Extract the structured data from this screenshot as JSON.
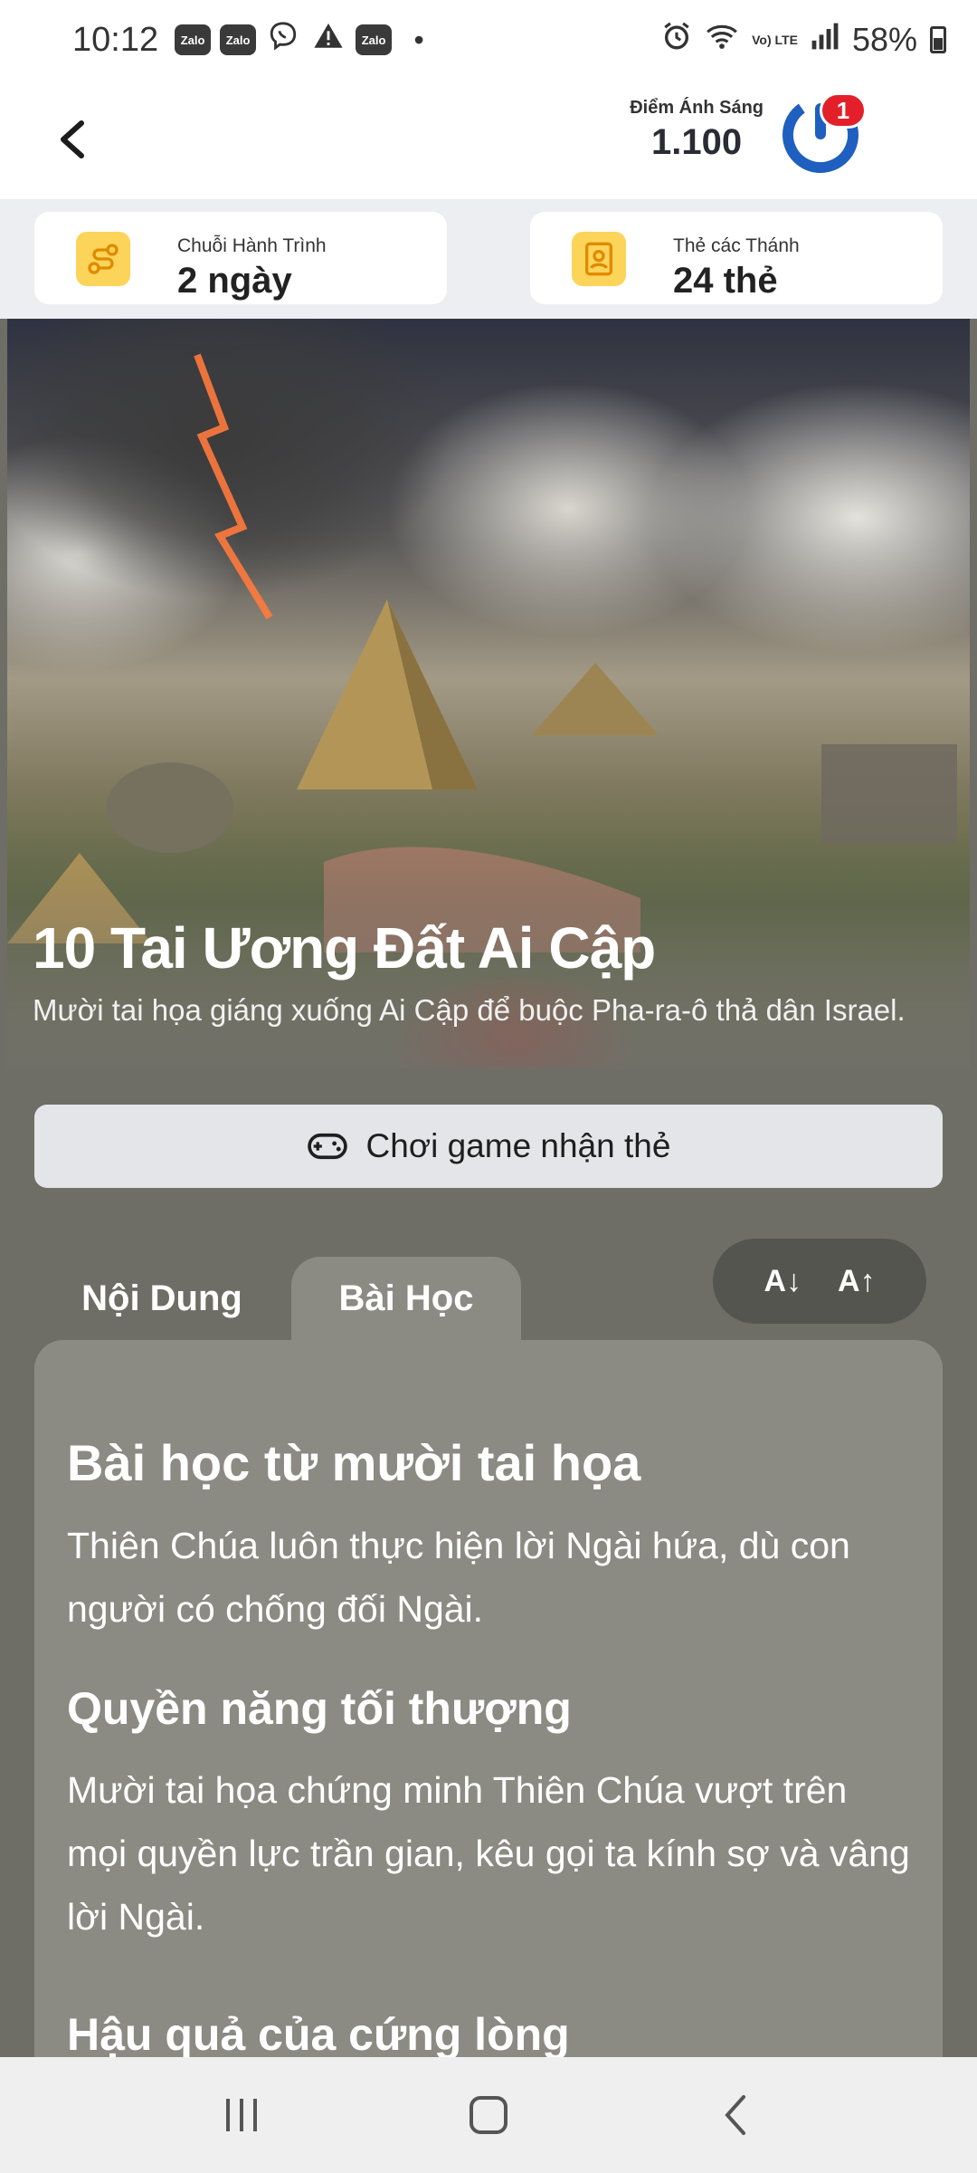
{
  "status_bar": {
    "time": "10:12",
    "notifications": [
      "Zalo",
      "Zalo",
      "viber-icon",
      "warning-icon",
      "Zalo",
      "dot-icon"
    ],
    "network_label": "Vo) LTE",
    "battery": "58%"
  },
  "header": {
    "points_label": "Điểm Ánh Sáng",
    "points_value": "1.100",
    "notification_count": "1",
    "brand_color": "#1e5fbf"
  },
  "stats": {
    "journey_label": "Chuỗi Hành Trình",
    "journey_value": "2 ngày",
    "saints_label": "Thẻ các Thánh",
    "saints_value": "24 thẻ"
  },
  "hero": {
    "title": "10 Tai Ương Đất Ai Cập",
    "description": "Mười tai họa giáng xuống Ai Cập để buộc Pha-ra-ô thả dân Israel."
  },
  "play_button": {
    "label": "Chơi game nhận thẻ"
  },
  "tabs": {
    "content": "Nội Dung",
    "lesson": "Bài Học",
    "active": "lesson"
  },
  "font_controls": {
    "decrease": "A↓",
    "increase": "A↑"
  },
  "lesson": {
    "heading": "Bài học từ mười tai họa",
    "intro": "Thiên Chúa luôn thực hiện lời Ngài hứa, dù con người có chống đối Ngài.",
    "section1_title": "Quyền năng tối thượng",
    "section1_text": "Mười tai họa chứng minh Thiên Chúa vượt trên mọi quyền lực trần gian, kêu gọi ta kính sợ và vâng lời Ngài.",
    "section2_title": "Hậu quả của cứng lòng"
  }
}
